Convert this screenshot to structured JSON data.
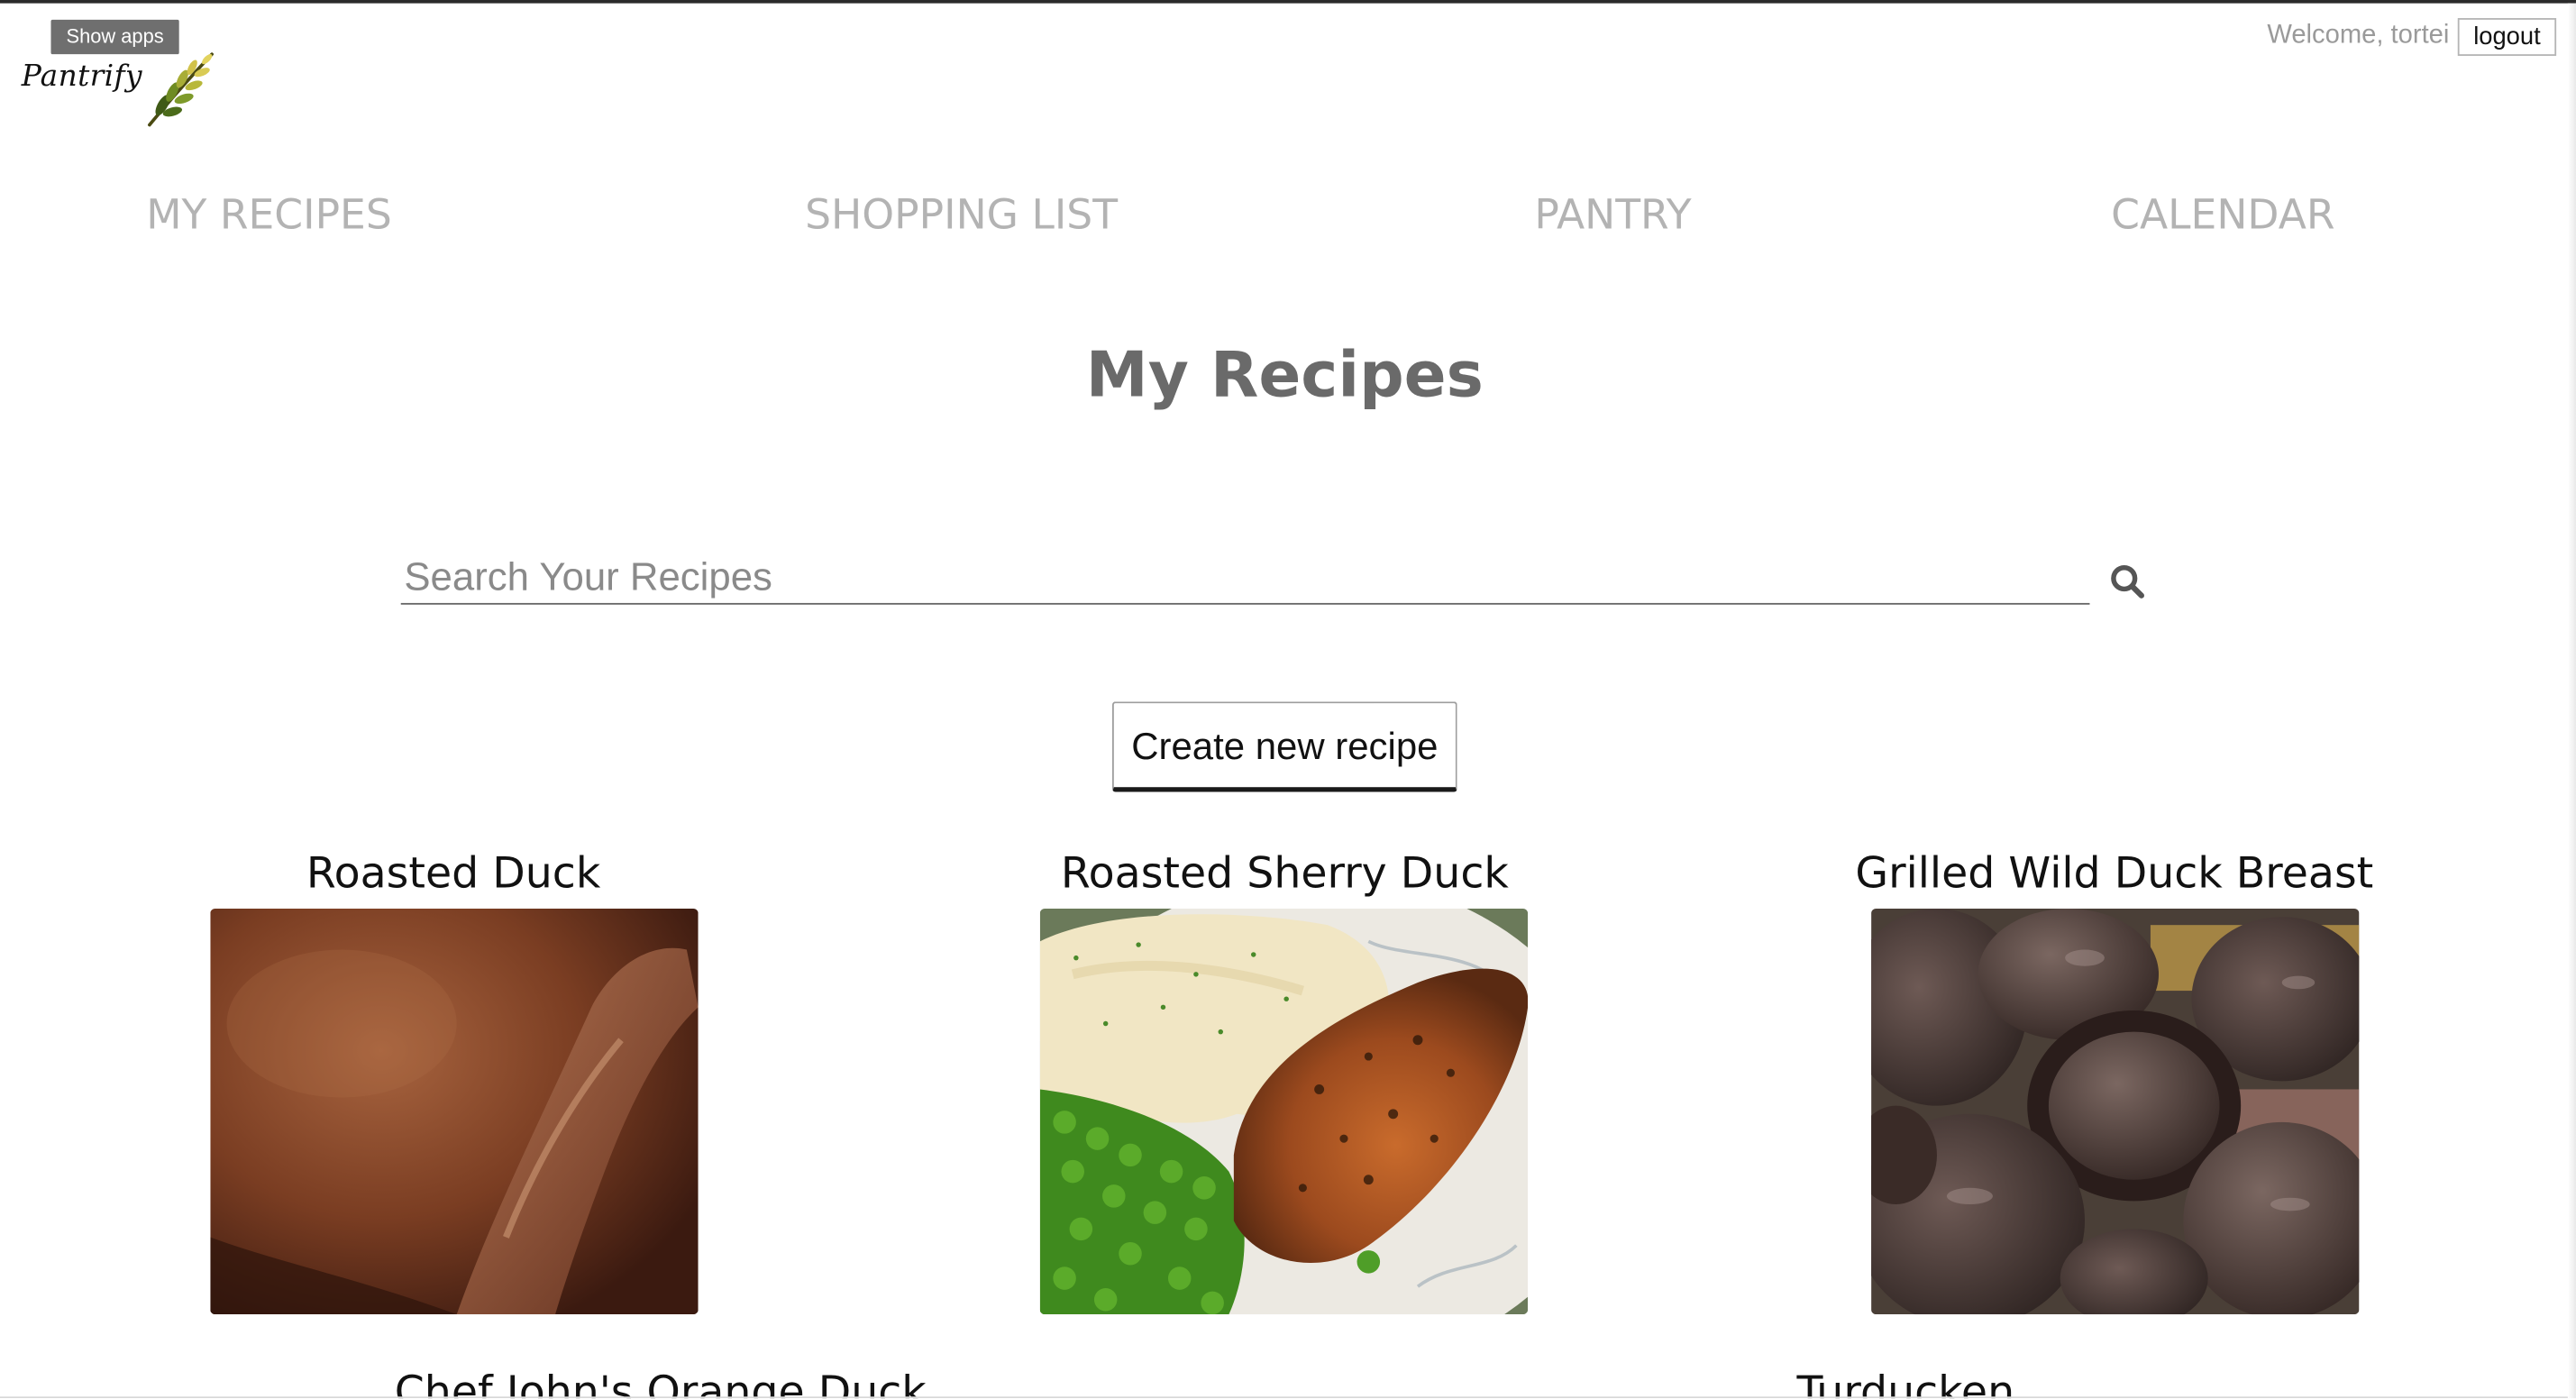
{
  "app": {
    "name": "Pantrify",
    "show_apps_label": "Show apps"
  },
  "user": {
    "welcome": "Welcome, tortei",
    "logout_label": "logout"
  },
  "nav": {
    "items": [
      {
        "label": "MY RECIPES"
      },
      {
        "label": "SHOPPING LIST"
      },
      {
        "label": "PANTRY"
      },
      {
        "label": "CALENDAR"
      }
    ]
  },
  "page": {
    "title": "My Recipes"
  },
  "search": {
    "placeholder": "Search Your Recipes",
    "icon": "search-icon"
  },
  "actions": {
    "create_label": "Create new recipe"
  },
  "recipes": [
    {
      "title": "Roasted Duck",
      "photo": "roasted-duck-photo"
    },
    {
      "title": "Roasted Sherry Duck",
      "photo": "roasted-sherry-duck-photo"
    },
    {
      "title": "Grilled Wild Duck Breast",
      "photo": "grilled-wild-duck-breast-photo"
    },
    {
      "title": "Chef John's Orange Duck",
      "photo": ""
    },
    {
      "title": "Turducken",
      "photo": ""
    }
  ],
  "colors": {
    "nav_text": "#b3b3b3",
    "title_text": "#6a6a6a",
    "badge_bg": "#6f6f6f",
    "accent_wheat": "#b8b83a"
  }
}
